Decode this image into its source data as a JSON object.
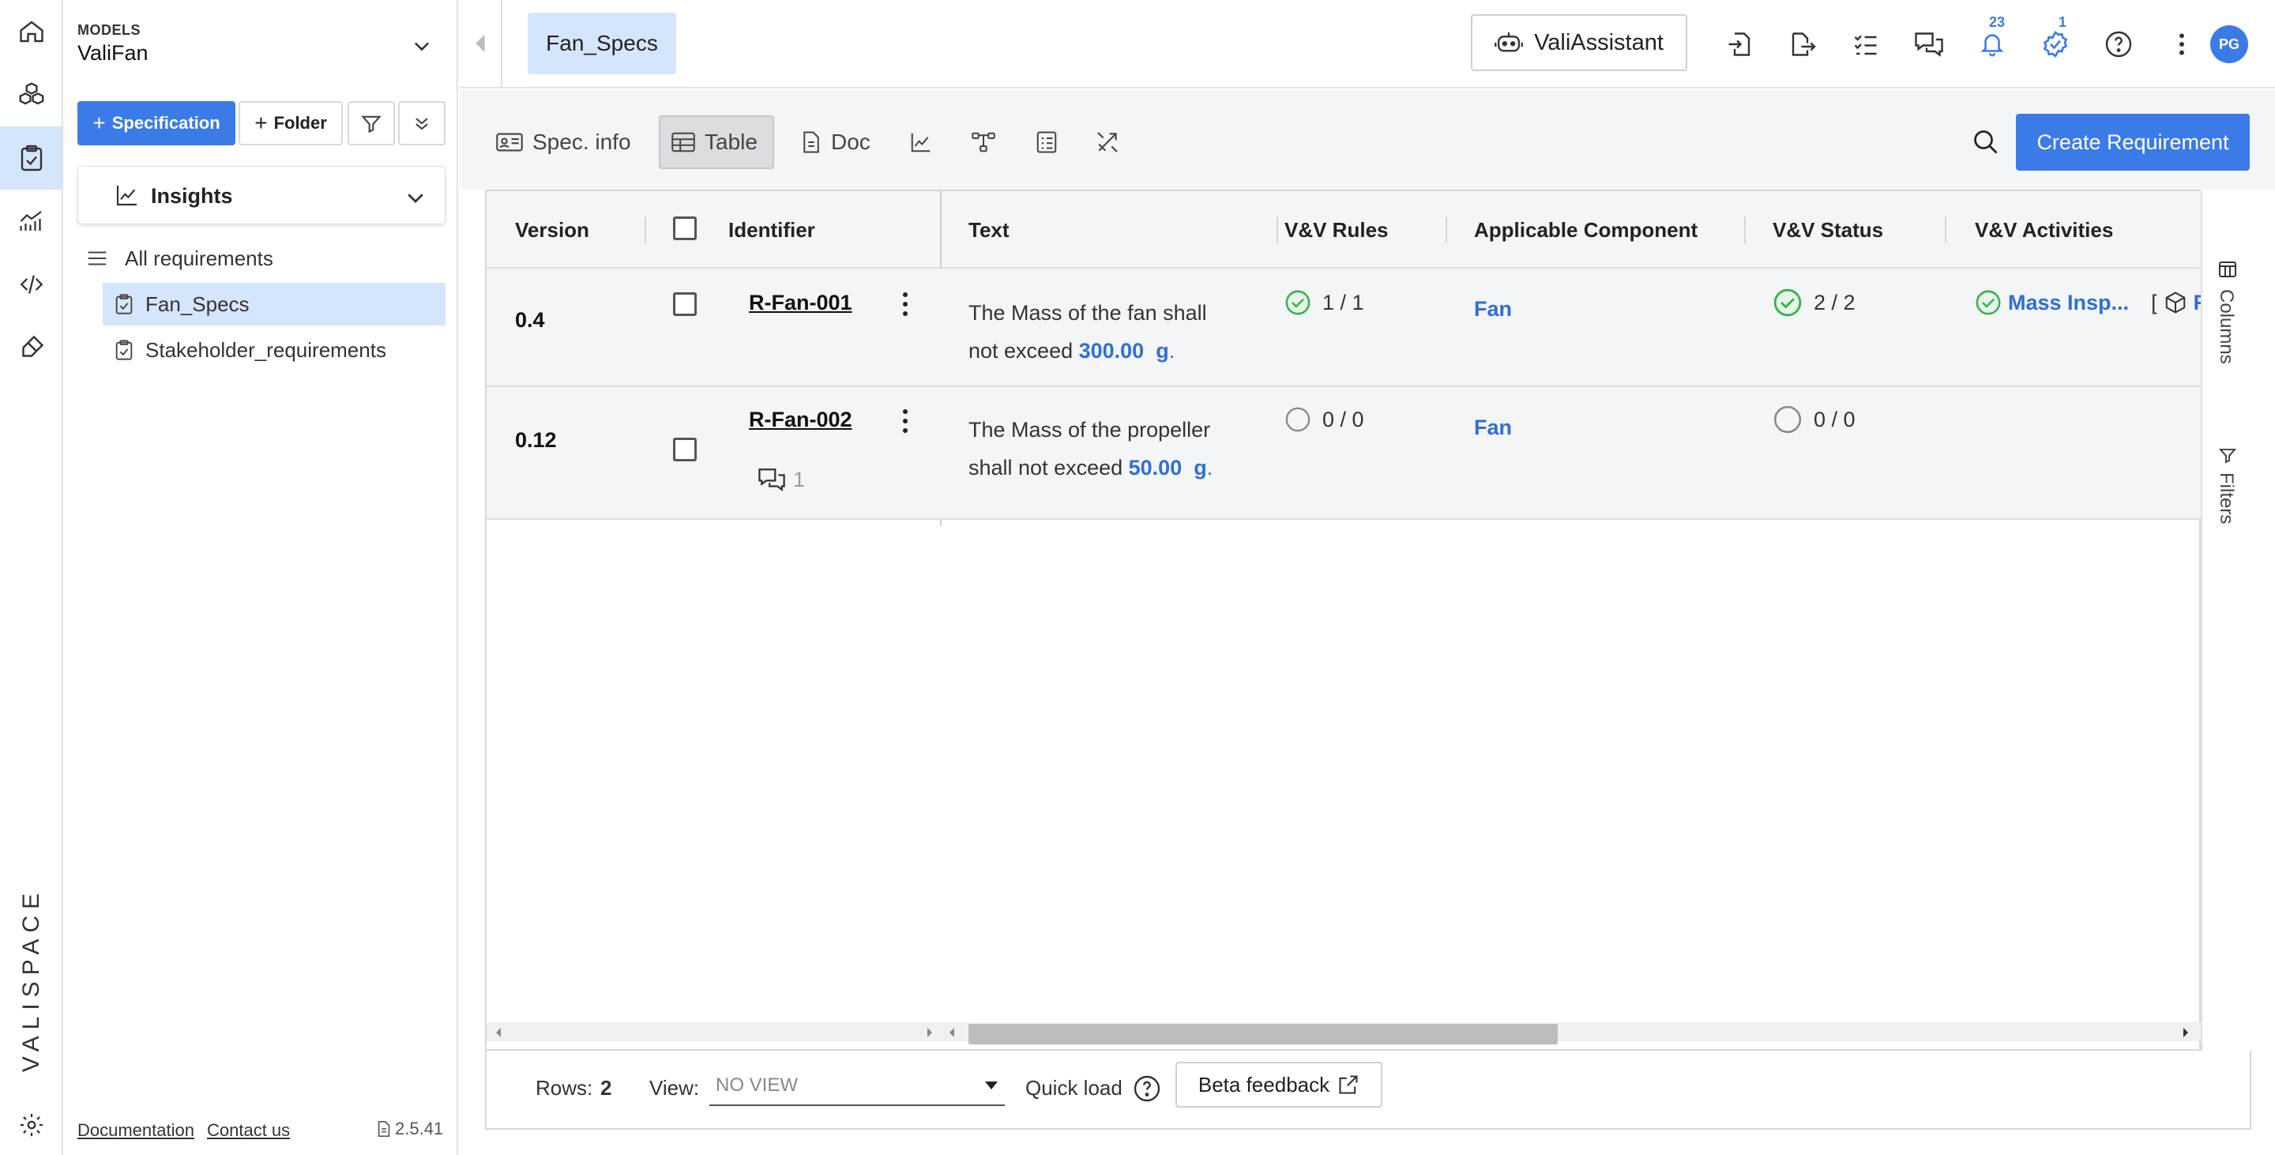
{
  "rail": {
    "logo_text": "VALISPACE"
  },
  "sidebar": {
    "models_label": "MODELS",
    "model_name": "ValiFan",
    "specification_label": "Specification",
    "folder_label": "Folder",
    "insights_label": "Insights",
    "tree": {
      "all_requirements": "All requirements",
      "items": [
        "Fan_Specs",
        "Stakeholder_requirements"
      ]
    },
    "footer": {
      "documentation": "Documentation",
      "contact": "Contact us",
      "version": "2.5.41"
    }
  },
  "topbar": {
    "active_tab": "Fan_Specs",
    "assistant_label": "ValiAssistant",
    "notifications_count": "23",
    "tasks_count": "1",
    "avatar_initials": "PG"
  },
  "toolbar": {
    "spec_info": "Spec. info",
    "table": "Table",
    "doc": "Doc",
    "create_requirement": "Create Requirement"
  },
  "table": {
    "headers": {
      "version": "Version",
      "identifier": "Identifier",
      "text": "Text",
      "vv_rules": "V&V Rules",
      "applicable_component": "Applicable Component",
      "vv_status": "V&V Status",
      "vv_activities": "V&V Activities"
    },
    "rows": [
      {
        "version": "0.4",
        "identifier": "R-Fan-001",
        "text_line1": "The Mass of the fan shall",
        "text_line2_prefix": "not exceed ",
        "value": "300.00",
        "unit": "g",
        "suffix": ".",
        "vv_rules": "1 / 1",
        "component": "Fan",
        "vv_status": "2 / 2",
        "activity": "Mass Insp...",
        "activity_extra_bracket": "[",
        "activity_extra": "F..."
      },
      {
        "version": "0.12",
        "identifier": "R-Fan-002",
        "comments": "1",
        "text_line1": "The Mass of the propeller",
        "text_line2_prefix": "shall not exceed ",
        "value": "50.00",
        "unit": "g",
        "suffix": ".",
        "vv_rules": "0 / 0",
        "component": "Fan",
        "vv_status": "0 / 0"
      }
    ],
    "side": {
      "columns": "Columns",
      "filters": "Filters"
    }
  },
  "bottombar": {
    "rows_label": "Rows:",
    "rows_value": "2",
    "view_label": "View:",
    "view_value": "NO VIEW",
    "quick_load": "Quick load",
    "beta_feedback": "Beta feedback"
  },
  "colors": {
    "accent": "#3b7be8",
    "selected_bg": "#d5e5fb",
    "success": "#37b34a"
  }
}
